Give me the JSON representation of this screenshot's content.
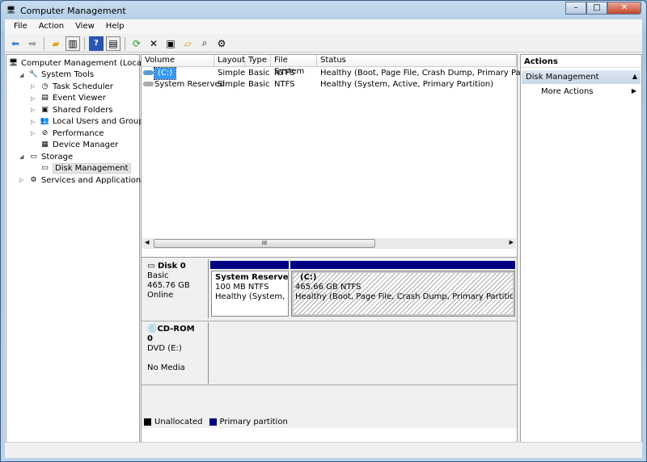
{
  "window": {
    "title": "Computer Management",
    "minimize": "–",
    "maximize": "□",
    "close": "✕"
  },
  "menu": [
    "File",
    "Action",
    "View",
    "Help"
  ],
  "toolbar": [
    "back-icon",
    "forward-icon",
    "up-folder-icon",
    "show-hide-tree-icon",
    "help-icon",
    "show-hide-action-pane-icon",
    "refresh-icon",
    "delete-icon",
    "properties-icon",
    "open-icon",
    "search-icon",
    "settings-icon"
  ],
  "tree": [
    {
      "label": "Computer Management (Local)",
      "level": 0,
      "icon": "computer-icon",
      "expander": ""
    },
    {
      "label": "System Tools",
      "level": 1,
      "icon": "tools-icon",
      "expander": "◢"
    },
    {
      "label": "Task Scheduler",
      "level": 2,
      "icon": "clock-icon",
      "expander": "▷"
    },
    {
      "label": "Event Viewer",
      "level": 2,
      "icon": "event-viewer-icon",
      "expander": "▷"
    },
    {
      "label": "Shared Folders",
      "level": 2,
      "icon": "shared-folder-icon",
      "expander": "▷"
    },
    {
      "label": "Local Users and Groups",
      "level": 2,
      "icon": "users-icon",
      "expander": "▷"
    },
    {
      "label": "Performance",
      "level": 2,
      "icon": "performance-icon",
      "expander": "▷"
    },
    {
      "label": "Device Manager",
      "level": 2,
      "icon": "device-manager-icon",
      "expander": ""
    },
    {
      "label": "Storage",
      "level": 1,
      "icon": "storage-icon",
      "expander": "◢"
    },
    {
      "label": "Disk Management",
      "level": 2,
      "icon": "disk-icon",
      "expander": "",
      "selected": true
    },
    {
      "label": "Services and Applications",
      "level": 1,
      "icon": "services-icon",
      "expander": "▷"
    }
  ],
  "volumes": {
    "columns": [
      "Volume",
      "Layout",
      "Type",
      "File System",
      "Status"
    ],
    "rows": [
      [
        "(C:)",
        "Simple",
        "Basic",
        "NTFS",
        "Healthy (Boot, Page File, Crash Dump, Primary Partition)"
      ],
      [
        "System Reserved",
        "Simple",
        "Basic",
        "NTFS",
        "Healthy (System, Active, Primary Partition)"
      ]
    ],
    "scroll_thumb": "III"
  },
  "disks": [
    {
      "name": "Disk 0",
      "type": "Basic",
      "size": "465.76 GB",
      "state": "Online",
      "partitions": [
        {
          "name": "System Reserved",
          "size": "100 MB NTFS",
          "status": "Healthy (System, Ac"
        },
        {
          "name": "(C:)",
          "size": "465.66 GB NTFS",
          "status": "Healthy (Boot, Page File, Crash Dump, Primary Partition)"
        }
      ]
    },
    {
      "name": "CD-ROM 0",
      "type": "DVD (E:)",
      "state": "No Media"
    }
  ],
  "legend": [
    {
      "label": "Unallocated",
      "color": "#000000"
    },
    {
      "label": "Primary partition",
      "color": "#000080"
    }
  ],
  "actions": {
    "header": "Actions",
    "section": "Disk Management",
    "more": "More Actions"
  }
}
